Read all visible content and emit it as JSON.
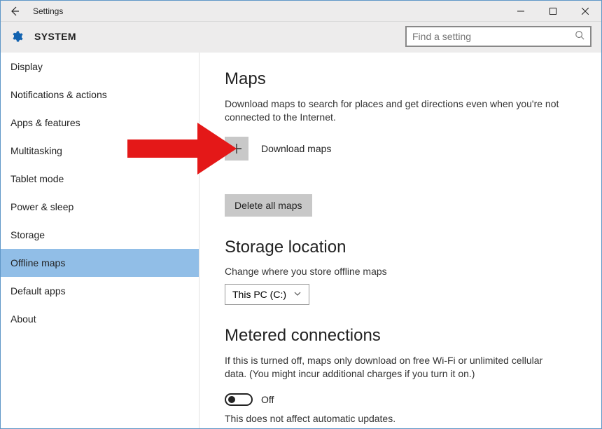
{
  "window": {
    "title": "Settings",
    "page_label": "SYSTEM",
    "search_placeholder": "Find a setting"
  },
  "sidebar": {
    "items": [
      {
        "label": "Display",
        "selected": false
      },
      {
        "label": "Notifications & actions",
        "selected": false
      },
      {
        "label": "Apps & features",
        "selected": false
      },
      {
        "label": "Multitasking",
        "selected": false
      },
      {
        "label": "Tablet mode",
        "selected": false
      },
      {
        "label": "Power & sleep",
        "selected": false
      },
      {
        "label": "Storage",
        "selected": false
      },
      {
        "label": "Offline maps",
        "selected": true
      },
      {
        "label": "Default apps",
        "selected": false
      },
      {
        "label": "About",
        "selected": false
      }
    ]
  },
  "main": {
    "maps": {
      "heading": "Maps",
      "description": "Download maps to search for places and get directions even when you're not connected to the Internet.",
      "download_label": "Download maps",
      "delete_button": "Delete all maps"
    },
    "storage": {
      "heading": "Storage location",
      "sub_label": "Change where you store offline maps",
      "selected_drive": "This PC (C:)"
    },
    "metered": {
      "heading": "Metered connections",
      "description": "If this is turned off, maps only download on free Wi-Fi or unlimited cellular data. (You might incur additional charges if you turn it on.)",
      "toggle_state": "Off",
      "note": "This does not affect automatic updates."
    }
  },
  "annotation": {
    "arrow_color": "#e41818"
  }
}
